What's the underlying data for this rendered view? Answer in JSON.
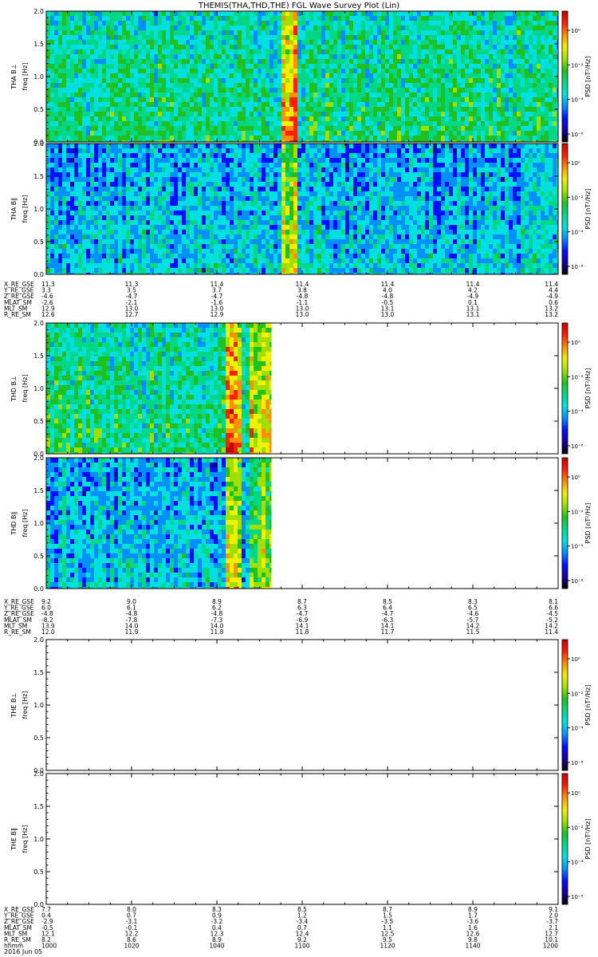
{
  "title": "THEMIS(THA,THD,THE) FGL Wave Survey Plot (Lin)",
  "colorbar": {
    "label": "PSD [nT²/Hz]",
    "ticks": [
      "10⁰",
      "10⁻²",
      "10⁻⁴",
      "10⁻⁶"
    ]
  },
  "colors": {
    "spectrum": [
      "#000000",
      "#1a00a0",
      "#0010ff",
      "#0090ff",
      "#00e0e0",
      "#00d888",
      "#20c020",
      "#a0e000",
      "#f0f000",
      "#ff9000",
      "#ff2000",
      "#c00000"
    ]
  },
  "chart_data": [
    {
      "type": "heatmap",
      "probe": "THA",
      "component": "B⊥",
      "ylabel": "THA B⊥",
      "yunit": "freq [Hz]",
      "ylim": [
        0,
        2.0
      ],
      "yticks": [
        "0.0",
        "0.5",
        "1.0",
        "1.5",
        "2.0"
      ],
      "xlim_hhmm": [
        1000,
        1200
      ],
      "data_extent_fraction": 1.0,
      "bright_bands_hhmm": [
        1055,
        1058
      ],
      "intensity": "high"
    },
    {
      "type": "heatmap",
      "probe": "THA",
      "component": "B∥",
      "ylabel": "THA B∥",
      "yunit": "freq [Hz]",
      "ylim": [
        0,
        2.0
      ],
      "yticks": [
        "0.0",
        "0.5",
        "1.0",
        "1.5",
        "2.0"
      ],
      "xlim_hhmm": [
        1000,
        1200
      ],
      "data_extent_fraction": 1.0,
      "bright_bands_hhmm": [
        1055,
        1058
      ],
      "intensity": "low"
    },
    {
      "type": "heatmap",
      "probe": "THD",
      "component": "B⊥",
      "ylabel": "THD B⊥",
      "yunit": "freq [Hz]",
      "ylim": [
        0,
        2.0
      ],
      "yticks": [
        "0.0",
        "0.5",
        "1.0",
        "1.5",
        "2.0"
      ],
      "xlim_hhmm": [
        1000,
        1200
      ],
      "data_extent_fraction": 0.44,
      "bright_bands_hhmm": [
        1042,
        1045
      ],
      "intensity": "high"
    },
    {
      "type": "heatmap",
      "probe": "THD",
      "component": "B∥",
      "ylabel": "THD B∥",
      "yunit": "freq [Hz]",
      "ylim": [
        0,
        2.0
      ],
      "yticks": [
        "0.0",
        "0.5",
        "1.0",
        "1.5",
        "2.0"
      ],
      "xlim_hhmm": [
        1000,
        1200
      ],
      "data_extent_fraction": 0.44,
      "bright_bands_hhmm": [
        1042,
        1045
      ],
      "intensity": "low"
    },
    {
      "type": "heatmap",
      "probe": "THE",
      "component": "B⊥",
      "ylabel": "THE B⊥",
      "yunit": "freq [Hz]",
      "ylim": [
        0,
        2.0
      ],
      "yticks": [
        "0.0",
        "0.5",
        "1.0",
        "1.5",
        "2.0"
      ],
      "xlim_hhmm": [
        1000,
        1200
      ],
      "data_extent_fraction": 0.0,
      "bright_bands_hhmm": [],
      "intensity": "none"
    },
    {
      "type": "heatmap",
      "probe": "THE",
      "component": "B∥",
      "ylabel": "THE B∥",
      "yunit": "freq [Hz]",
      "ylim": [
        0,
        2.0
      ],
      "yticks": [
        "0.0",
        "0.5",
        "1.0",
        "1.5",
        "2.0"
      ],
      "xlim_hhmm": [
        1000,
        1200
      ],
      "data_extent_fraction": 0.0,
      "bright_bands_hhmm": [],
      "intensity": "none"
    }
  ],
  "ephemeris": [
    {
      "probe": "THA",
      "rows": [
        {
          "label": "X_RE_GSE",
          "values": [
            "11.3",
            "11.3",
            "11.4",
            "11.4",
            "11.4",
            "11.4",
            "11.4"
          ]
        },
        {
          "label": "Y_RE_GSE",
          "values": [
            "3.3",
            "3.5",
            "3.7",
            "3.8",
            "4.0",
            "4.2",
            "4.4"
          ]
        },
        {
          "label": "Z_RE_GSE",
          "values": [
            "-4.6",
            "-4.7",
            "-4.7",
            "-4.8",
            "-4.8",
            "-4.9",
            "-4.9"
          ]
        },
        {
          "label": "MLAT_SM",
          "values": [
            "-2.6",
            "-2.1",
            "-1.6",
            "-1.1",
            "-0.5",
            "0.1",
            "0.6"
          ]
        },
        {
          "label": "MLT_SM",
          "values": [
            "12.9",
            "13.0",
            "13.0",
            "13.0",
            "13.1",
            "13.1",
            "13.2"
          ]
        },
        {
          "label": "R_RE_SM",
          "values": [
            "12.6",
            "12.7",
            "12.9",
            "13.0",
            "13.0",
            "13.1",
            "13.2"
          ]
        }
      ]
    },
    {
      "probe": "THD",
      "rows": [
        {
          "label": "X_RE_GSE",
          "values": [
            "9.2",
            "9.0",
            "8.9",
            "8.7",
            "8.5",
            "8.3",
            "8.1"
          ]
        },
        {
          "label": "Y_RE_GSE",
          "values": [
            "6.0",
            "6.1",
            "6.2",
            "6.3",
            "6.4",
            "6.5",
            "6.6"
          ]
        },
        {
          "label": "Z_RE_GSE",
          "values": [
            "-4.8",
            "-4.8",
            "-4.8",
            "-4.7",
            "-4.7",
            "-4.6",
            "-4.5"
          ]
        },
        {
          "label": "MLAT_SM",
          "values": [
            "-8.2",
            "-7.8",
            "-7.3",
            "-6.9",
            "-6.3",
            "-5.7",
            "-5.2"
          ]
        },
        {
          "label": "MLT_SM",
          "values": [
            "13.9",
            "14.0",
            "14.0",
            "14.1",
            "14.1",
            "14.2",
            "14.2"
          ]
        },
        {
          "label": "R_RE_SM",
          "values": [
            "12.0",
            "11.9",
            "11.8",
            "11.8",
            "11.7",
            "11.5",
            "11.4"
          ]
        }
      ]
    },
    {
      "probe": "THE",
      "rows": [
        {
          "label": "X_RE_GSE",
          "values": [
            "7.7",
            "8.0",
            "8.3",
            "8.5",
            "8.7",
            "8.9",
            "9.1"
          ]
        },
        {
          "label": "Y_RE_GSE",
          "values": [
            "0.4",
            "0.7",
            "0.9",
            "1.2",
            "1.5",
            "1.7",
            "2.0"
          ]
        },
        {
          "label": "Z_RE_GSE",
          "values": [
            "-2.9",
            "-3.1",
            "-3.2",
            "-3.4",
            "-3.5",
            "-3.6",
            "-3.7"
          ]
        },
        {
          "label": "MLAT_SM",
          "values": [
            "-0.5",
            "-0.1",
            "0.4",
            "0.7",
            "1.1",
            "1.6",
            "2.1"
          ]
        },
        {
          "label": "MLT_SM",
          "values": [
            "12.1",
            "12.2",
            "12.3",
            "12.4",
            "12.5",
            "12.6",
            "12.7"
          ]
        },
        {
          "label": "R_RE_SM",
          "values": [
            "8.2",
            "8.6",
            "8.9",
            "9.2",
            "9.5",
            "9.8",
            "10.1"
          ]
        },
        {
          "label": "hhmm",
          "values": [
            "1000",
            "1020",
            "1040",
            "1100",
            "1120",
            "1140",
            "1200"
          ]
        }
      ]
    }
  ],
  "date_label": "2016 Jun 05"
}
